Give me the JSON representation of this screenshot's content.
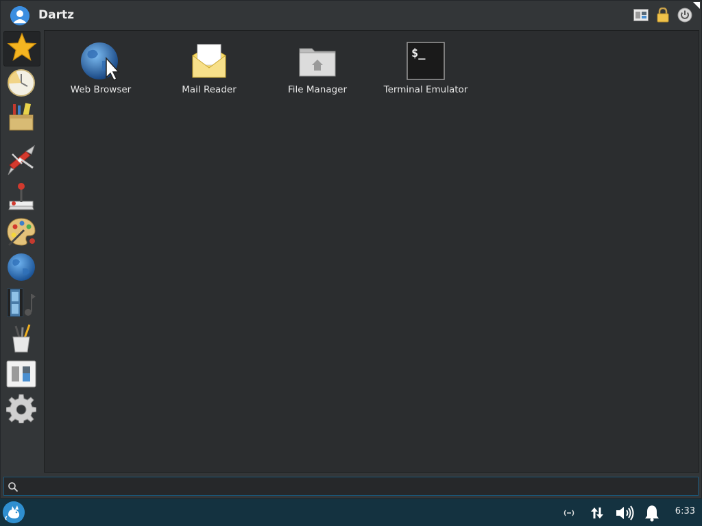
{
  "header": {
    "username": "Dartz",
    "icons": [
      "avatar-icon",
      "settings-manager-icon",
      "lock-icon",
      "power-icon"
    ]
  },
  "sidebar": {
    "categories": [
      {
        "icon": "favorites-star-icon",
        "active": true
      },
      {
        "icon": "recently-used-clock-icon",
        "active": false
      },
      {
        "icon": "accessories-icon",
        "active": false
      },
      {
        "icon": "system-tools-knife-icon",
        "active": false
      },
      {
        "icon": "games-joystick-icon",
        "active": false
      },
      {
        "icon": "graphics-palette-icon",
        "active": false
      },
      {
        "icon": "internet-globe-icon",
        "active": false
      },
      {
        "icon": "multimedia-icon",
        "active": false
      },
      {
        "icon": "office-brushes-icon",
        "active": false
      },
      {
        "icon": "settings-switch-icon",
        "active": false
      },
      {
        "icon": "system-gear-icon",
        "active": false
      }
    ]
  },
  "apps": [
    {
      "label": "Web Browser",
      "icon": "web-browser-icon"
    },
    {
      "label": "Mail Reader",
      "icon": "mail-reader-icon"
    },
    {
      "label": "File Manager",
      "icon": "file-manager-icon"
    },
    {
      "label": "Terminal Emulator",
      "icon": "terminal-emulator-icon",
      "glyph": "$_"
    }
  ],
  "search": {
    "placeholder": "",
    "value": ""
  },
  "taskbar": {
    "clock": "6:33",
    "tray": [
      "network-idle-icon",
      "transfer-arrows-icon",
      "volume-icon",
      "notification-bell-icon"
    ]
  },
  "colors": {
    "window_bg": "#333638",
    "content_bg": "#2b2d2f",
    "taskbar_bg": "#143240",
    "accent": "#1a5678"
  }
}
